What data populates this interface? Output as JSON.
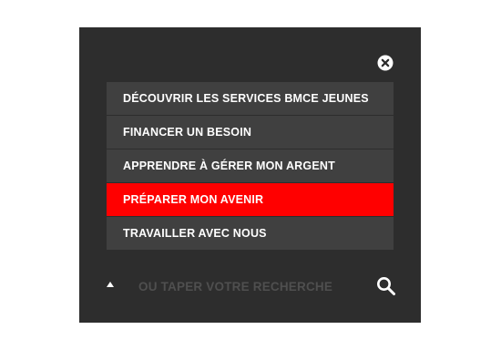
{
  "overlay": {
    "close_icon": "close-circle-icon",
    "menu": {
      "items": [
        {
          "label": "DÉCOUVRIR LES SERVICES BMCE JEUNES",
          "active": false
        },
        {
          "label": "FINANCER UN BESOIN",
          "active": false
        },
        {
          "label": "APPRENDRE À GÉRER MON ARGENT",
          "active": false
        },
        {
          "label": "PRÉPARER MON AVENIR",
          "active": true
        },
        {
          "label": "TRAVAILLER AVEC NOUS",
          "active": false
        }
      ]
    },
    "search": {
      "placeholder": "OU TAPER VOTRE RECHERCHE",
      "value": "",
      "icon": "search-icon",
      "toggle_icon": "triangle-up-icon"
    },
    "colors": {
      "panel_bg": "#2d2d2d",
      "item_bg": "#404040",
      "active_bg": "#ff0000",
      "text": "#ffffff",
      "placeholder": "#4f4f4f"
    }
  }
}
